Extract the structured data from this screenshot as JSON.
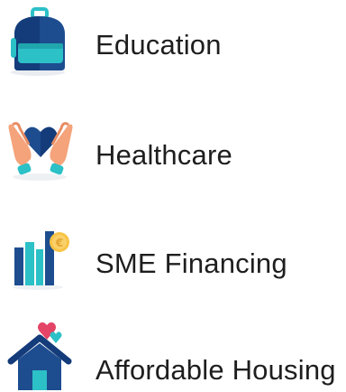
{
  "items": [
    {
      "label": "Education",
      "icon": "backpack-icon"
    },
    {
      "label": "Healthcare",
      "icon": "hands-heart-icon"
    },
    {
      "label": "SME Financing",
      "icon": "bar-chart-coin-icon"
    },
    {
      "label": "Affordable Housing",
      "icon": "house-heart-icon"
    }
  ],
  "colors": {
    "navy": "#143c7a",
    "teal": "#2cc0c7",
    "heart": "#e44466",
    "skin": "#f5a37a",
    "coin": "#f7c445"
  }
}
